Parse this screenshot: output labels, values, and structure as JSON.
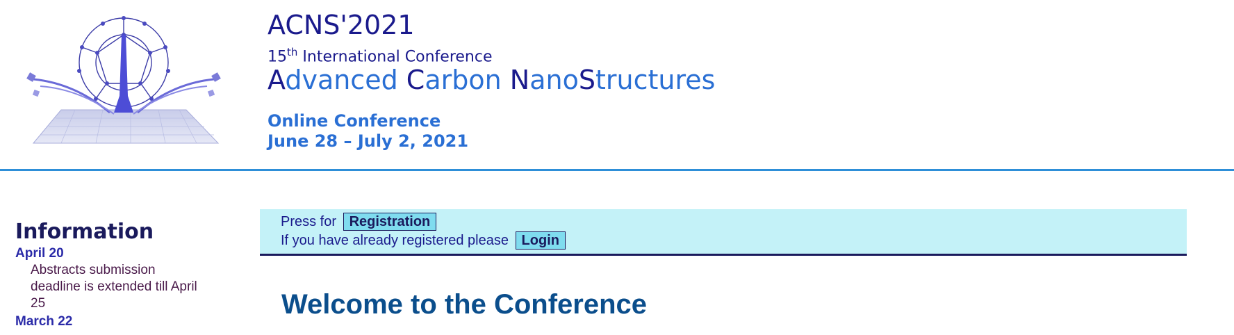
{
  "header": {
    "title": "ACNS'2021",
    "edition_number": "15",
    "edition_suffix": "th",
    "edition_text": " International Conference",
    "name_parts": [
      {
        "text": "A",
        "cap": true
      },
      {
        "text": "dvanced ",
        "cap": false
      },
      {
        "text": "C",
        "cap": true
      },
      {
        "text": "arbon ",
        "cap": false
      },
      {
        "text": "N",
        "cap": true
      },
      {
        "text": "ano",
        "cap": false
      },
      {
        "text": "S",
        "cap": true
      },
      {
        "text": "tructures",
        "cap": false
      }
    ],
    "format": "Online Conference",
    "dates": "June 28 – July 2, 2021",
    "logo_icon": "fullerene-tower-logo"
  },
  "sidebar": {
    "title": "Information",
    "news": [
      {
        "date": "April 20",
        "text": "Abstracts submission deadline is extended till April 25"
      },
      {
        "date": "March 22",
        "text": ""
      }
    ]
  },
  "notice": {
    "line1_text": "Press for",
    "registration_label": "Registration",
    "line2_text": "If you have already registered please",
    "login_label": "Login"
  },
  "main": {
    "heading": "Welcome to the Conference"
  },
  "colors": {
    "accent_blue": "#2a6fd4",
    "dark_navy": "#1a1a8c",
    "notice_bg": "#c4f2f8",
    "header_rule": "#2e8fd8"
  }
}
